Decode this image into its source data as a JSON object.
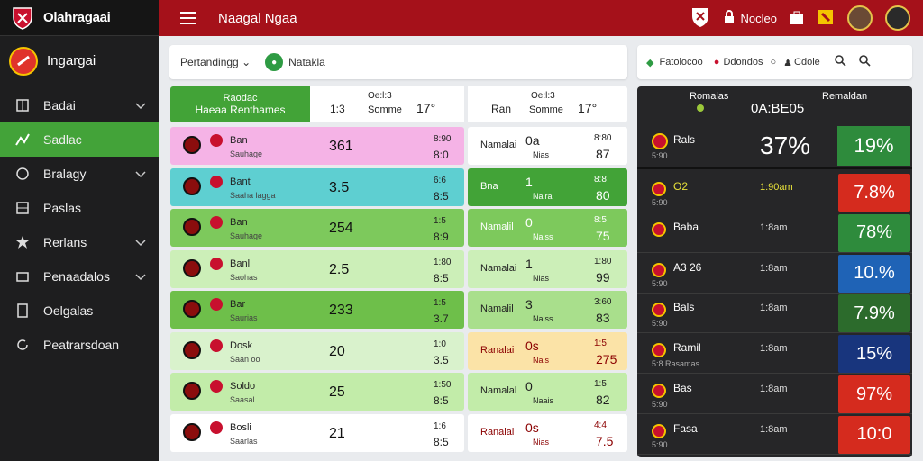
{
  "app": {
    "logo_text": "Olahragaai",
    "top_title": "Naagal Ngaa",
    "top_right_label": "Nocleo"
  },
  "sidebar": {
    "profile_name": "Ingargai",
    "items": [
      {
        "label": "Badai"
      },
      {
        "label": "Sadlac"
      },
      {
        "label": "Bralagy"
      },
      {
        "label": "Paslas"
      },
      {
        "label": "Rerlans"
      },
      {
        "label": "Penaadalos"
      },
      {
        "label": "Oelgalas"
      },
      {
        "label": "Peatrarsdoan"
      }
    ]
  },
  "filters": {
    "main_dropdown": "Pertandingg",
    "main_tag": "Natakla",
    "right_items": [
      "Fatolocoo",
      "Ddondos",
      "Cdole"
    ]
  },
  "table_header": {
    "col1_a": "Raodac",
    "col1_b": "Haeaa Renthames",
    "col2_a": "1:3",
    "col2_b": "Oe:l:3",
    "col2_c": "Somme",
    "col2_d": "17°",
    "col3_a": "Ran",
    "col3_b": "Oe:l:3",
    "col3_c": "Somme",
    "col3_d": "17°"
  },
  "matches": [
    {
      "name": "Ban",
      "sub": "Sauhage",
      "score": "361",
      "odd_a": "8:90",
      "odd_b": "8:0",
      "mid": "Namalai",
      "m_val": "0a",
      "m_sub": "Nias",
      "r_a": "8:80",
      "r_b": "87"
    },
    {
      "name": "Bant",
      "sub": "Saaha lagga",
      "score": "3.5",
      "odd_a": "6:6",
      "odd_b": "8:5",
      "mid": "Bna",
      "m_val": "1",
      "m_sub": "Naira",
      "r_a": "8:8",
      "r_b": "80"
    },
    {
      "name": "Ban",
      "sub": "Sauhage",
      "score": "254",
      "odd_a": "1:5",
      "odd_b": "8:9",
      "mid": "Namalil",
      "m_val": "0",
      "m_sub": "Naiss",
      "r_a": "8:5",
      "r_b": "75"
    },
    {
      "name": "Banl",
      "sub": "Saohas",
      "score": "2.5",
      "odd_a": "1:80",
      "odd_b": "8:5",
      "mid": "Namalai",
      "m_val": "1",
      "m_sub": "Nias",
      "r_a": "1:80",
      "r_b": "99"
    },
    {
      "name": "Bar",
      "sub": "Saurias",
      "score": "233",
      "odd_a": "1:5",
      "odd_b": "3.7",
      "mid": "Namalil",
      "m_val": "3",
      "m_sub": "Naiss",
      "r_a": "3:60",
      "r_b": "83"
    },
    {
      "name": "Dosk",
      "sub": "Saan oo",
      "score": "20",
      "odd_a": "1:0",
      "odd_b": "3.5",
      "mid": "Ranalai",
      "m_val": "0s",
      "m_sub": "Nais",
      "r_a": "1:5",
      "r_b": "275"
    },
    {
      "name": "Soldo",
      "sub": "Saasal",
      "score": "25",
      "odd_a": "1:50",
      "odd_b": "8:5",
      "mid": "Namalal",
      "m_val": "0",
      "m_sub": "Naais",
      "r_a": "1:5",
      "r_b": "82"
    },
    {
      "name": "Bosli",
      "sub": "Saarlas",
      "score": "21",
      "odd_a": "1:6",
      "odd_b": "8:5",
      "mid": "Ranalai",
      "m_val": "0s",
      "m_sub": "Nias",
      "r_a": "4:4",
      "r_b": "7.5"
    }
  ],
  "right_panel": {
    "header_left": "Romalas",
    "header_right": "Remaldan",
    "header_odds": "0A:BE05",
    "top": {
      "name": "Rals",
      "sub": "5:90",
      "pct_a": "37%",
      "pct_b": "19%"
    },
    "rows": [
      {
        "name": "O2",
        "sub": "5:90",
        "val": "1:90am",
        "pct": "7.8%",
        "color": "#d52b1e"
      },
      {
        "name": "Baba",
        "sub": "",
        "val": "1:8am",
        "pct": "78%",
        "color": "#2e8b3c"
      },
      {
        "name": "A3 26",
        "sub": "5:90",
        "val": "1:8am",
        "pct": "10.%",
        "color": "#1f63b6"
      },
      {
        "name": "Bals",
        "sub": "5:90",
        "val": "1:8am",
        "pct": "7.9%",
        "color": "#2c6b2c"
      },
      {
        "name": "Ramil",
        "sub": "5:8 Rasamas",
        "val": "1:8am",
        "pct": "15%",
        "color": "#18357d"
      },
      {
        "name": "Bas",
        "sub": "5:90",
        "val": "1:8am",
        "pct": "97%",
        "color": "#d52b1e"
      },
      {
        "name": "Fasa",
        "sub": "5:90",
        "val": "1:8am",
        "pct": "10:0",
        "color": "#d52b1e"
      }
    ]
  }
}
